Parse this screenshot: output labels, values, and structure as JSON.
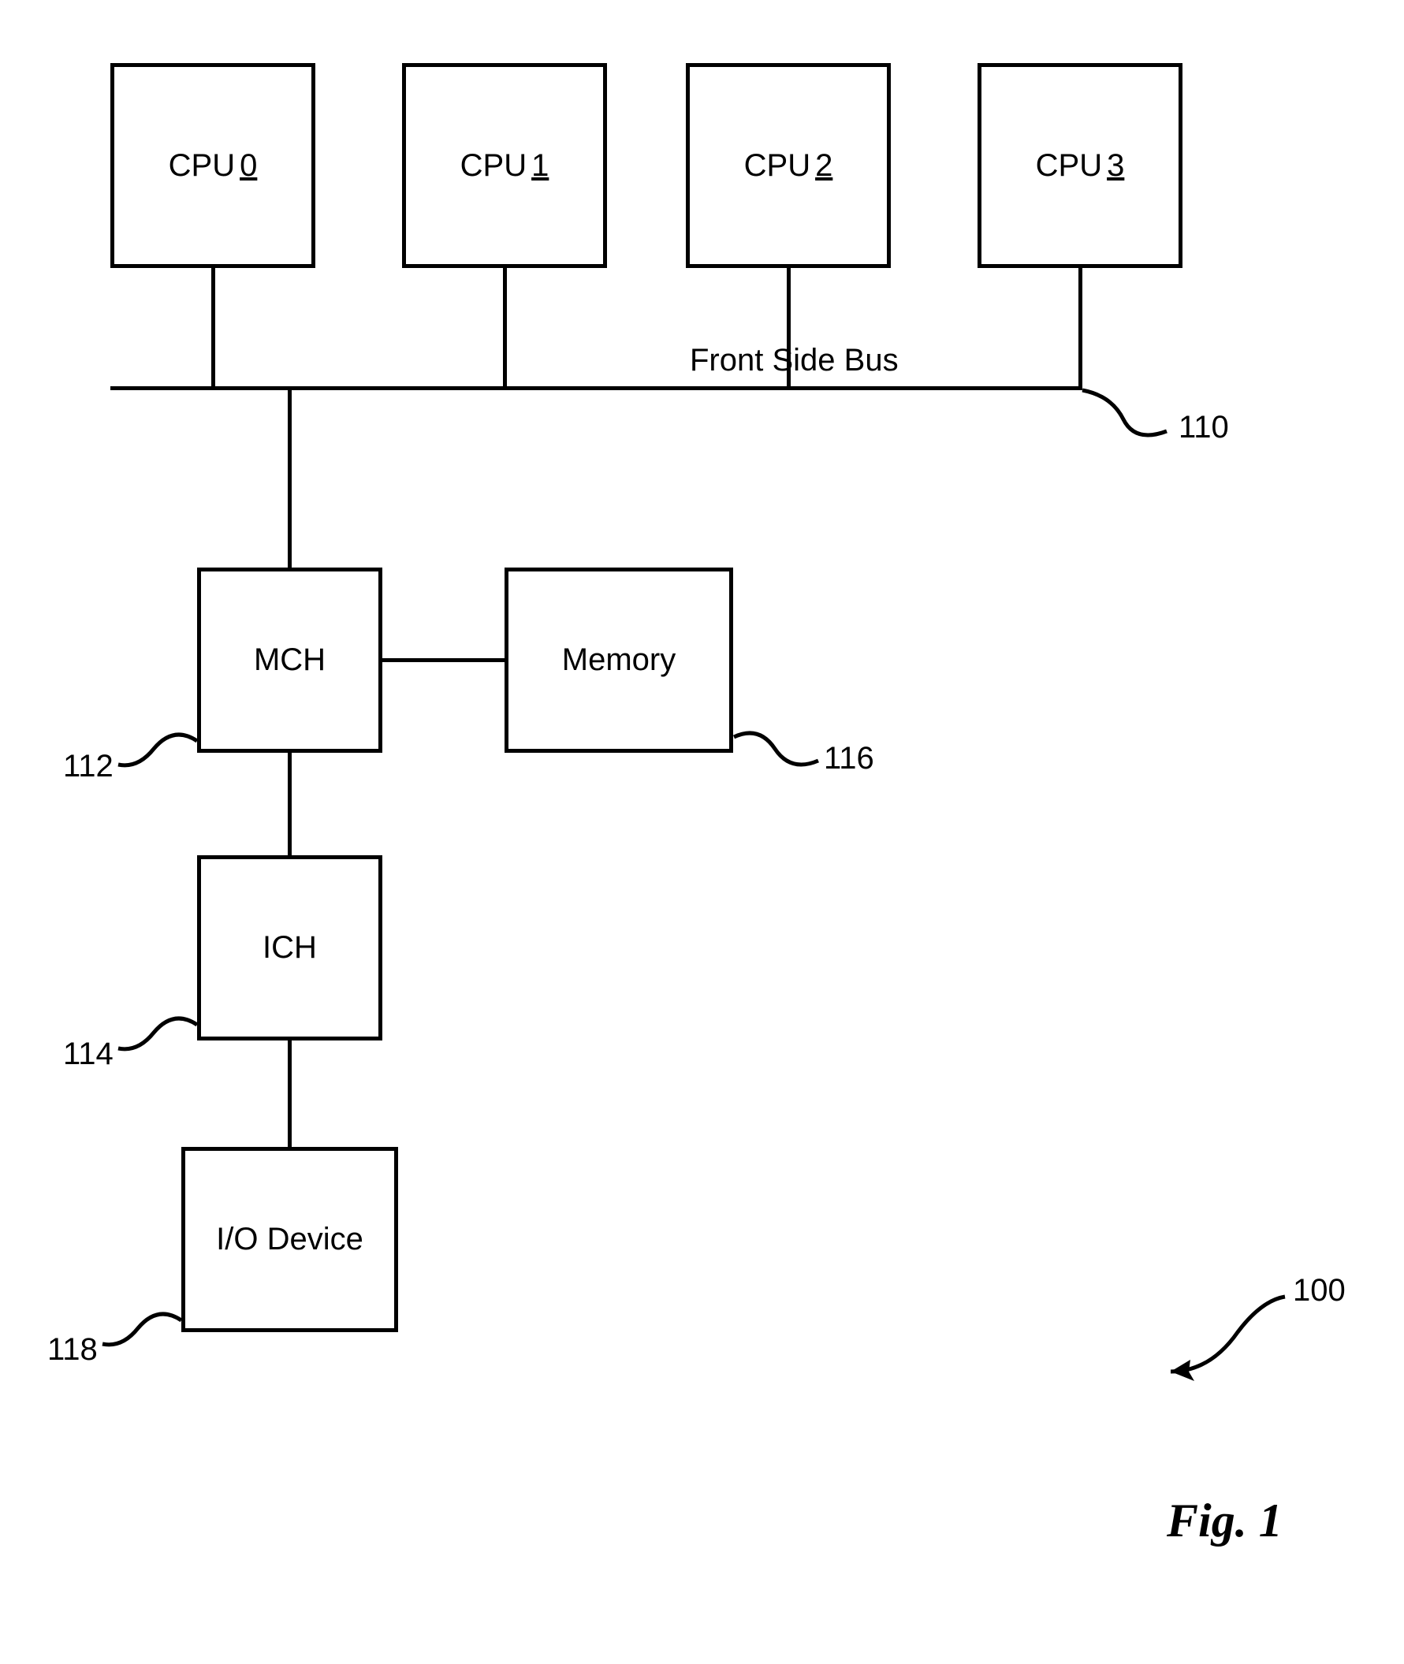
{
  "cpus": [
    {
      "label": "CPU",
      "num": "0"
    },
    {
      "label": "CPU",
      "num": "1"
    },
    {
      "label": "CPU",
      "num": "2"
    },
    {
      "label": "CPU",
      "num": "3"
    }
  ],
  "bus_label": "Front Side Bus",
  "bus_ref": "110",
  "mch": {
    "label": "MCH",
    "ref": "112"
  },
  "ich": {
    "label": "ICH",
    "ref": "114"
  },
  "memory": {
    "label": "Memory",
    "ref": "116"
  },
  "io": {
    "label": "I/O Device",
    "ref": "118"
  },
  "system_ref": "100",
  "figure": "Fig. 1"
}
